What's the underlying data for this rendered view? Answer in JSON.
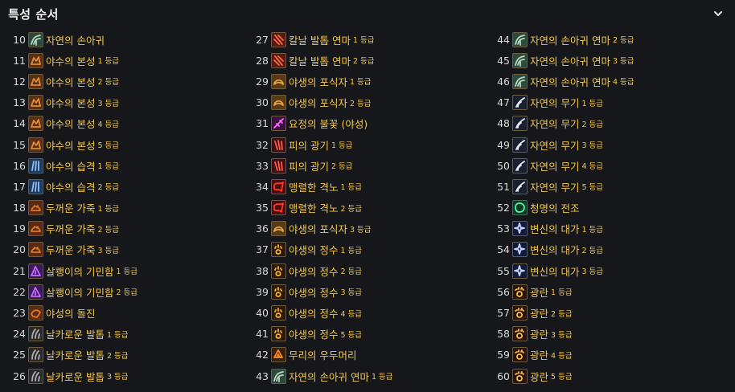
{
  "header": {
    "title": "특성 순서",
    "toggle_icon": "chevron-down-icon"
  },
  "columns": [
    [
      {
        "num": "10",
        "name": "자연의 손아귀",
        "rank": "",
        "icon": "nature-grasp-icon"
      },
      {
        "num": "11",
        "name": "야수의 본성",
        "rank": "1 등급",
        "icon": "beast-nature-icon"
      },
      {
        "num": "12",
        "name": "야수의 본성",
        "rank": "2 등급",
        "icon": "beast-nature-icon"
      },
      {
        "num": "13",
        "name": "야수의 본성",
        "rank": "3 등급",
        "icon": "beast-nature-icon"
      },
      {
        "num": "14",
        "name": "야수의 본성",
        "rank": "4 등급",
        "icon": "beast-nature-icon"
      },
      {
        "num": "15",
        "name": "야수의 본성",
        "rank": "5 등급",
        "icon": "beast-nature-icon"
      },
      {
        "num": "16",
        "name": "야수의 습격",
        "rank": "1 등급",
        "icon": "claw-blue-icon"
      },
      {
        "num": "17",
        "name": "야수의 습격",
        "rank": "2 등급",
        "icon": "claw-blue-icon"
      },
      {
        "num": "18",
        "name": "두꺼운 가죽",
        "rank": "1 등급",
        "icon": "bear-hide-icon"
      },
      {
        "num": "19",
        "name": "두꺼운 가죽",
        "rank": "2 등급",
        "icon": "bear-hide-icon"
      },
      {
        "num": "20",
        "name": "두꺼운 가죽",
        "rank": "3 등급",
        "icon": "bear-hide-icon"
      },
      {
        "num": "21",
        "name": "살쾡이의 기민함",
        "rank": "1 등급",
        "icon": "purple-cat-icon"
      },
      {
        "num": "22",
        "name": "살쾡이의 기민함",
        "rank": "2 등급",
        "icon": "purple-cat-icon"
      },
      {
        "num": "23",
        "name": "야성의 돌진",
        "rank": "",
        "icon": "feral-charge-icon"
      },
      {
        "num": "24",
        "name": "날카로운 발톱",
        "rank": "1 등급",
        "icon": "sharp-claw-icon"
      },
      {
        "num": "25",
        "name": "날카로운 발톱",
        "rank": "2 등급",
        "icon": "sharp-claw-icon"
      },
      {
        "num": "26",
        "name": "날카로운 발톱",
        "rank": "3 등급",
        "icon": "sharp-claw-icon"
      }
    ],
    [
      {
        "num": "27",
        "name": "칼날 발톱 연마",
        "rank": "1 등급",
        "icon": "blade-claw-icon"
      },
      {
        "num": "28",
        "name": "칼날 발톱 연마",
        "rank": "2 등급",
        "icon": "blade-claw-icon"
      },
      {
        "num": "29",
        "name": "야생의 포식자",
        "rank": "1 등급",
        "icon": "predator-icon"
      },
      {
        "num": "30",
        "name": "야생의 포식자",
        "rank": "2 등급",
        "icon": "predator-icon"
      },
      {
        "num": "31",
        "name": "요정의 불꽃 (야성)",
        "rank": "",
        "icon": "faerie-fire-icon"
      },
      {
        "num": "32",
        "name": "피의 광기",
        "rank": "1 등급",
        "icon": "blood-frenzy-icon"
      },
      {
        "num": "33",
        "name": "피의 광기",
        "rank": "2 등급",
        "icon": "blood-frenzy-icon"
      },
      {
        "num": "34",
        "name": "맹렬한 격노",
        "rank": "1 등급",
        "icon": "red-rage-icon"
      },
      {
        "num": "35",
        "name": "맹렬한 격노",
        "rank": "2 등급",
        "icon": "red-rage-icon"
      },
      {
        "num": "36",
        "name": "야생의 포식자",
        "rank": "3 등급",
        "icon": "predator-icon"
      },
      {
        "num": "37",
        "name": "야생의 정수",
        "rank": "1 등급",
        "icon": "paw-icon"
      },
      {
        "num": "38",
        "name": "야생의 정수",
        "rank": "2 등급",
        "icon": "paw-icon"
      },
      {
        "num": "39",
        "name": "야생의 정수",
        "rank": "3 등급",
        "icon": "paw-icon"
      },
      {
        "num": "40",
        "name": "야생의 정수",
        "rank": "4 등급",
        "icon": "paw-icon"
      },
      {
        "num": "41",
        "name": "야생의 정수",
        "rank": "5 등급",
        "icon": "paw-icon"
      },
      {
        "num": "42",
        "name": "무리의 우두머리",
        "rank": "",
        "icon": "pack-leader-icon"
      },
      {
        "num": "43",
        "name": "자연의 손아귀 연마",
        "rank": "1 등급",
        "icon": "nature-grasp-icon"
      }
    ],
    [
      {
        "num": "44",
        "name": "자연의 손아귀 연마",
        "rank": "2 등급",
        "icon": "nature-grasp-icon"
      },
      {
        "num": "45",
        "name": "자연의 손아귀 연마",
        "rank": "3 등급",
        "icon": "nature-grasp-icon"
      },
      {
        "num": "46",
        "name": "자연의 손아귀 연마",
        "rank": "4 등급",
        "icon": "nature-grasp-icon"
      },
      {
        "num": "47",
        "name": "자연의 무기",
        "rank": "1 등급",
        "icon": "nature-weapon-icon"
      },
      {
        "num": "48",
        "name": "자연의 무기",
        "rank": "2 등급",
        "icon": "nature-weapon-icon"
      },
      {
        "num": "49",
        "name": "자연의 무기",
        "rank": "3 등급",
        "icon": "nature-weapon-icon"
      },
      {
        "num": "50",
        "name": "자연의 무기",
        "rank": "4 등급",
        "icon": "nature-weapon-icon"
      },
      {
        "num": "51",
        "name": "자연의 무기",
        "rank": "5 등급",
        "icon": "nature-weapon-icon"
      },
      {
        "num": "52",
        "name": "청명의 전조",
        "rank": "",
        "icon": "green-orb-icon"
      },
      {
        "num": "53",
        "name": "변신의 대가",
        "rank": "1 등급",
        "icon": "shapeshift-star-icon"
      },
      {
        "num": "54",
        "name": "변신의 대가",
        "rank": "2 등급",
        "icon": "shapeshift-star-icon"
      },
      {
        "num": "55",
        "name": "변신의 대가",
        "rank": "3 등급",
        "icon": "shapeshift-star-icon"
      },
      {
        "num": "56",
        "name": "광란",
        "rank": "1 등급",
        "icon": "frenzy-paw-icon"
      },
      {
        "num": "57",
        "name": "광란",
        "rank": "2 등급",
        "icon": "frenzy-paw-icon"
      },
      {
        "num": "58",
        "name": "광란",
        "rank": "3 등급",
        "icon": "frenzy-paw-icon"
      },
      {
        "num": "59",
        "name": "광란",
        "rank": "4 등급",
        "icon": "frenzy-paw-icon"
      },
      {
        "num": "60",
        "name": "광란",
        "rank": "5 등급",
        "icon": "frenzy-paw-icon"
      }
    ]
  ],
  "colors": {
    "background": "#16171a",
    "talent_name": "#f3c64a",
    "row_number": "#d8d8d8",
    "icon_border": "#6b5c3e"
  }
}
